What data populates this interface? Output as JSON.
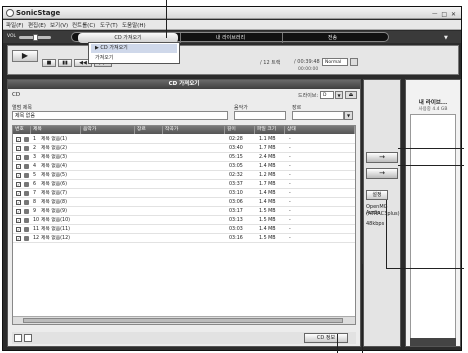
{
  "app": {
    "title": "SonicStage",
    "window_controls": "ㅡ □ ✕"
  },
  "menu": {
    "items": [
      "파일(F)",
      "편집(E)",
      "보기(V)",
      "컨트롤(C)",
      "도구(T)",
      "도움말(H)"
    ]
  },
  "toolbar": {
    "vol_label": "VOL",
    "tabs": [
      "CD 가져오기",
      "내 라이브러리",
      "전송"
    ],
    "tab_arrow": "▼"
  },
  "dropdown": {
    "items": [
      "▶ CD 가져오기",
      "가져오기"
    ]
  },
  "player": {
    "play_label": "▶",
    "stop_label": "■",
    "pause_label": "▮▮",
    "prev_label": "◀◀",
    "next_label": "▶▶",
    "track_count": "/ 12 트랙",
    "time_elapsed": "/ 00:39:48",
    "time_sub": "00:00:00",
    "mode": "Normal"
  },
  "main": {
    "header": "CD 가져오기",
    "cd_label": "CD",
    "drive_label": "드라이브:",
    "drive_value": "D",
    "eject": "⏏",
    "album_label": "앨범 제목",
    "artist_label": "음악가",
    "genre_label": "장르",
    "album_value": "제목 없음",
    "artist_value": "",
    "genre_value": "",
    "genre_arrow": "▼",
    "columns": [
      "번호",
      "제목",
      "음악가",
      "장르",
      "작곡가",
      "길이",
      "파일 크기",
      "상태"
    ],
    "tracks": [
      {
        "no": "1",
        "title": "제목 없음(1)",
        "length": "02:28",
        "size": "1.1 MB",
        "status": "-"
      },
      {
        "no": "2",
        "title": "제목 없음(2)",
        "length": "03:40",
        "size": "1.7 MB",
        "status": "-"
      },
      {
        "no": "3",
        "title": "제목 없음(3)",
        "length": "05:15",
        "size": "2.4 MB",
        "status": "-"
      },
      {
        "no": "4",
        "title": "제목 없음(4)",
        "length": "03:05",
        "size": "1.4 MB",
        "status": "-"
      },
      {
        "no": "5",
        "title": "제목 없음(5)",
        "length": "02:32",
        "size": "1.2 MB",
        "status": "-"
      },
      {
        "no": "6",
        "title": "제목 없음(6)",
        "length": "03:37",
        "size": "1.7 MB",
        "status": "-"
      },
      {
        "no": "7",
        "title": "제목 없음(7)",
        "length": "03:10",
        "size": "1.4 MB",
        "status": "-"
      },
      {
        "no": "8",
        "title": "제목 없음(8)",
        "length": "03:06",
        "length2": "",
        "size": "1.4 MB",
        "status": "-"
      },
      {
        "no": "9",
        "title": "제목 없음(9)",
        "length": "03:17",
        "size": "1.5 MB",
        "status": "-"
      },
      {
        "no": "10",
        "title": "제목 없음(10)",
        "length": "03:13",
        "size": "1.5 MB",
        "status": "-"
      },
      {
        "no": "11",
        "title": "제목 없음(11)",
        "length": "03:03",
        "size": "1.4 MB",
        "status": "-"
      },
      {
        "no": "12",
        "title": "제목 없음(12)",
        "length": "03:16",
        "size": "1.5 MB",
        "status": "-"
      }
    ],
    "check_mark": "✓",
    "cd_info_button": "CD 정보"
  },
  "side": {
    "import_arrow": "→",
    "import_btn2": "→",
    "settings_button": "설정",
    "format_label": "OpenMG Audio",
    "format_label2": "(ATRAC3plus)",
    "bitrate_label": "48kbps"
  },
  "library": {
    "title": "내 라이브...",
    "usage": "사용중 4.4 GB"
  },
  "colors": {
    "window_bg": "#2b2b2b",
    "header_dark": "#4a4a4a",
    "selection": "#cfd8ea"
  }
}
